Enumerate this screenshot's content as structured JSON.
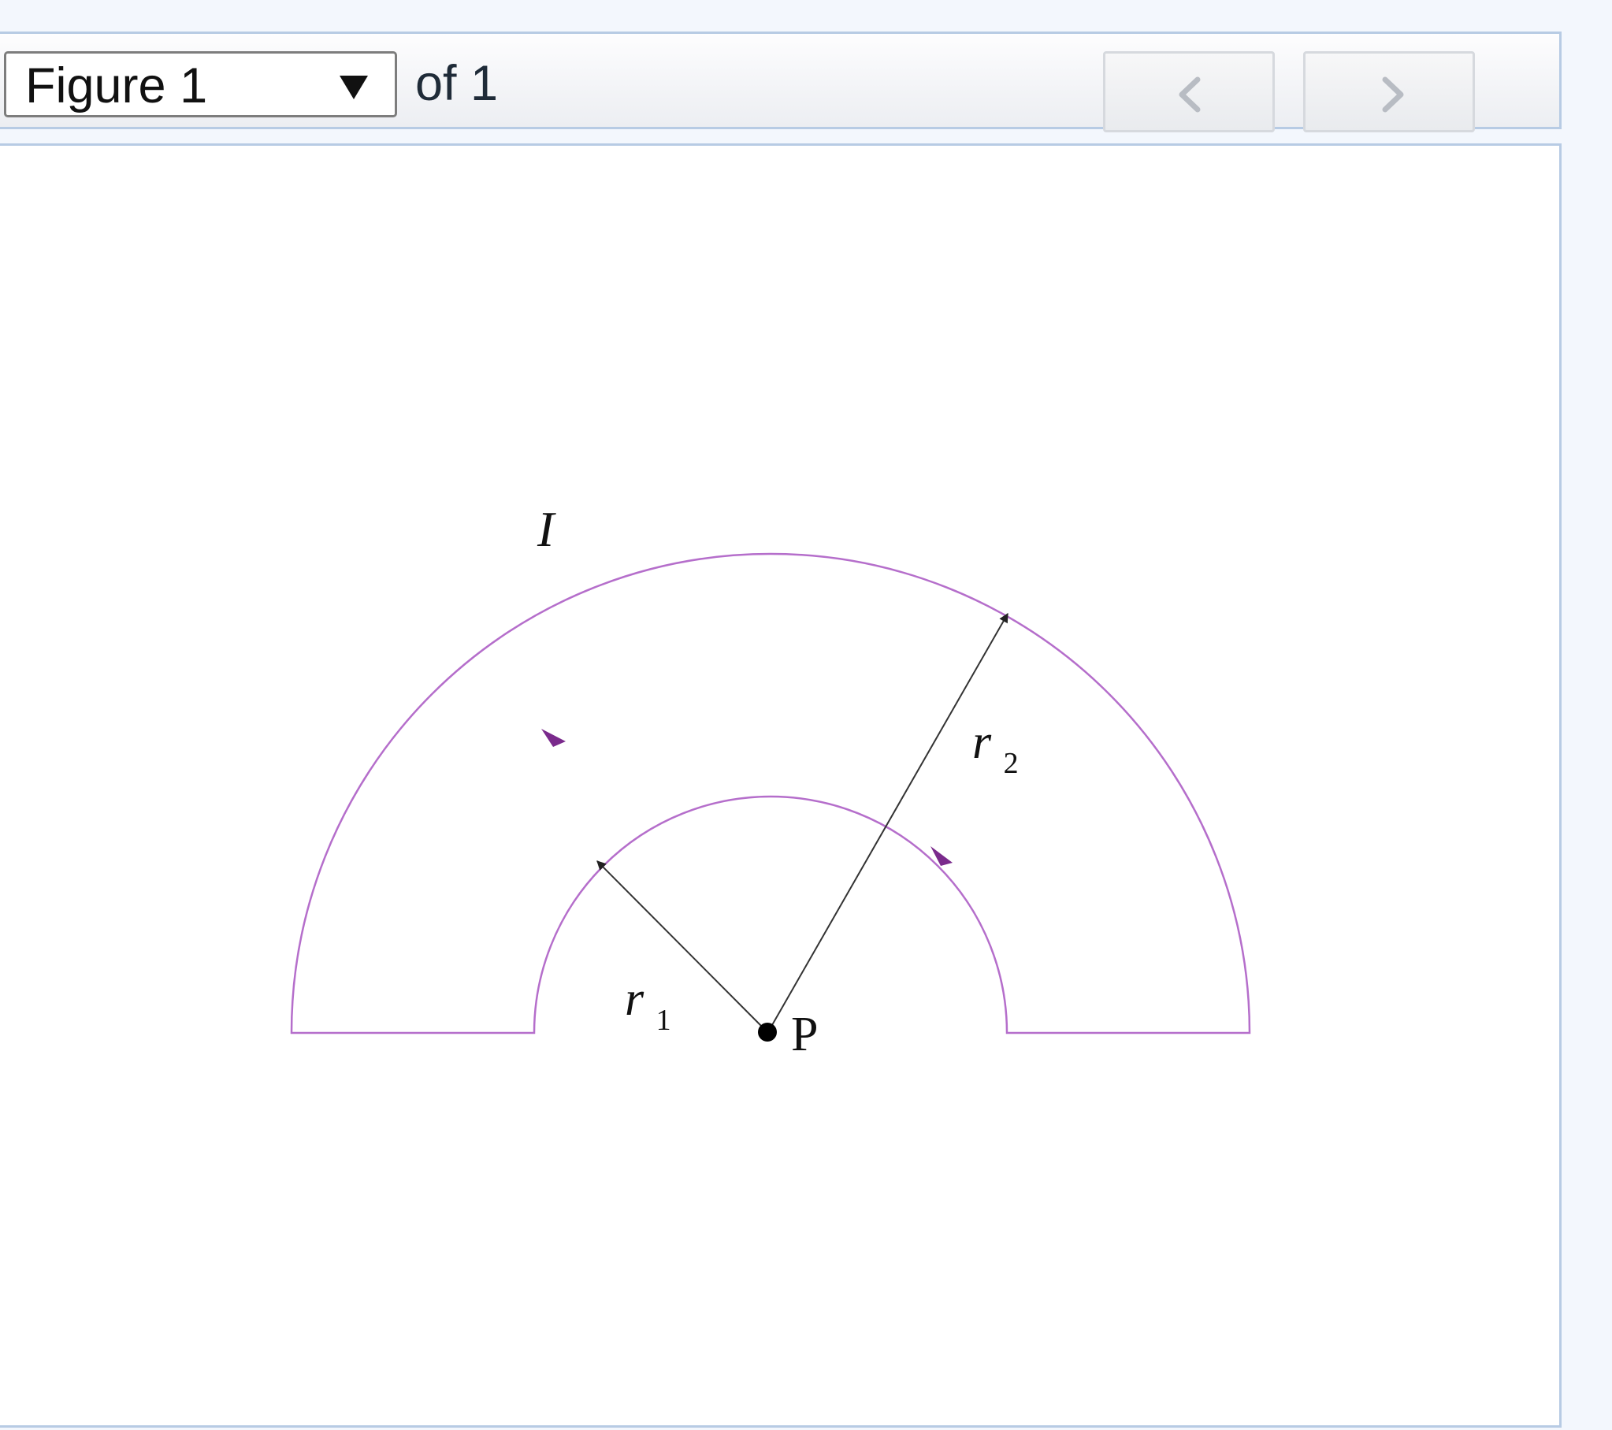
{
  "toolbar": {
    "figure_select_value": "Figure 1",
    "of_label": "of 1",
    "prev_icon": "chevron-left-icon",
    "next_icon": "chevron-right-icon"
  },
  "figure": {
    "current_label": "I",
    "radius_inner_label": "r",
    "radius_inner_subscript": "1",
    "radius_outer_label": "r",
    "radius_outer_subscript": "2",
    "point_label": "P"
  },
  "colors": {
    "wire": "#b56ecb",
    "arrow": "#7a2a8c",
    "lines": "#333333",
    "panel_border": "#b7cbe4",
    "page_background": "#f3f7fd"
  }
}
